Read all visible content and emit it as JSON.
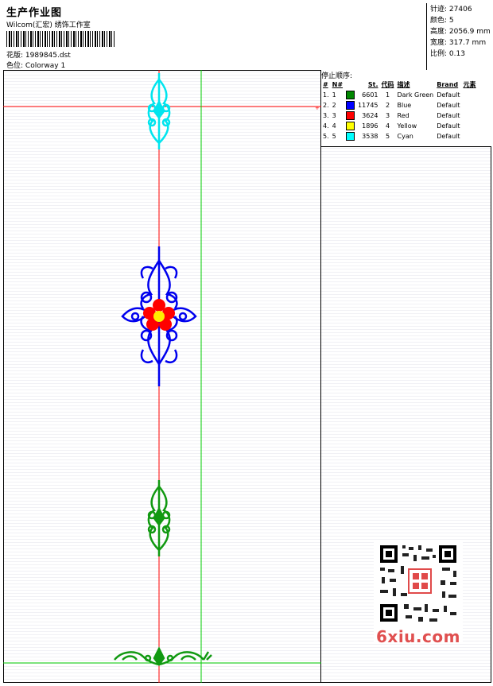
{
  "header": {
    "title": "生产作业图",
    "studio": "Wilcom(汇宏) 绣饰工作室",
    "design_label": "花版:",
    "design_value": "1989845.dst",
    "colorway_label": "色位:",
    "colorway_value": "Colorway 1"
  },
  "stats": [
    {
      "label": "针迹:",
      "value": "27406"
    },
    {
      "label": "颜色:",
      "value": "5"
    },
    {
      "label": "高度:",
      "value": "2056.9 mm"
    },
    {
      "label": "宽度:",
      "value": "317.7 mm"
    },
    {
      "label": "比例:",
      "value": "0.13"
    }
  ],
  "stop_table": {
    "title": "停止顺序:",
    "headers": [
      "#",
      "N#",
      "St.",
      "代码",
      "描述",
      "Brand",
      "元素"
    ],
    "rows": [
      {
        "idx": "1.",
        "n": "1",
        "color": "#008800",
        "st": "6601",
        "code": "1",
        "desc": "Dark Green",
        "brand": "Default"
      },
      {
        "idx": "2.",
        "n": "2",
        "color": "#0000ff",
        "st": "11745",
        "code": "2",
        "desc": "Blue",
        "brand": "Default"
      },
      {
        "idx": "3.",
        "n": "3",
        "color": "#ff0000",
        "st": "3624",
        "code": "3",
        "desc": "Red",
        "brand": "Default"
      },
      {
        "idx": "4.",
        "n": "4",
        "color": "#ffff00",
        "st": "1896",
        "code": "4",
        "desc": "Yellow",
        "brand": "Default"
      },
      {
        "idx": "5.",
        "n": "5",
        "color": "#00ffff",
        "st": "3538",
        "code": "5",
        "desc": "Cyan",
        "brand": "Default"
      }
    ]
  },
  "guides": {
    "horizontal_color": "#ff0000",
    "vertical_color": "#ff0000",
    "frame_color": "#00cc00"
  },
  "icons": {
    "qr": "qr-code-icon",
    "stamp": "red-seal-icon"
  },
  "watermark": {
    "text": "6xiu.com"
  }
}
